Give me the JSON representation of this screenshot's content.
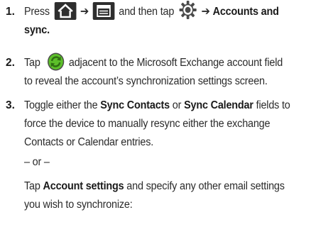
{
  "steps": [
    {
      "number": "1.",
      "line1": {
        "a": "Press",
        "b": "and then tap",
        "c": "Accounts and"
      },
      "line2": "sync."
    },
    {
      "number": "2.",
      "line1": {
        "a": "Tap",
        "b": "adjacent to the Microsoft Exchange account field"
      },
      "line2": "to reveal the account’s synchronization settings screen."
    },
    {
      "number": "3.",
      "line1": {
        "a": "Toggle either the",
        "b1": "Sync Contacts",
        "c": "or",
        "b2": "Sync Calendar",
        "d": "fields to"
      },
      "line2": "force the device to manually resync either the exchange",
      "line3": "Contacts or Calendar entries.",
      "or": "– or –",
      "line4": {
        "a": "Tap",
        "b": "Account settings",
        "c": "and specify any other email settings"
      },
      "line5": "you wish to synchronize:"
    }
  ],
  "arrow": "➔",
  "icons": [
    "home-icon",
    "menu-icon",
    "settings-gear-icon",
    "sync-icon"
  ],
  "colors": {
    "icon_dark": "#2e2e2e",
    "sync_green": "#5cbf2a",
    "text": "#2b2b2b"
  }
}
